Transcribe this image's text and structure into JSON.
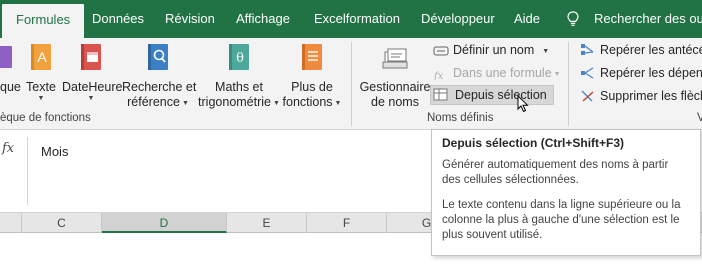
{
  "tabs": {
    "formules": "Formules",
    "donnees": "Données",
    "revision": "Révision",
    "affichage": "Affichage",
    "excelformation": "Excelformation",
    "developpeur": "Développeur",
    "aide": "Aide",
    "search": "Rechercher des outils"
  },
  "ribbon": {
    "func_library": {
      "partial_button": "que",
      "texte": "Texte",
      "dateheure": "DateHeure",
      "recherche_line1": "Recherche et",
      "recherche_line2": "référence",
      "maths_line1": "Maths et",
      "maths_line2": "trigonométrie",
      "plus_line1": "Plus de",
      "plus_line2": "fonctions",
      "group_label": "èque de fonctions"
    },
    "defined_names": {
      "gestionnaire_line1": "Gestionnaire",
      "gestionnaire_line2": "de noms",
      "definir_nom": "Définir un nom",
      "dans_formule": "Dans une formule",
      "depuis_selection": "Depuis sélection",
      "group_label": "Noms définis"
    },
    "auditing": {
      "reperer_antecedents": "Repérer les antécéd",
      "reperer_dependants": "Repérer les dépenda",
      "supprimer_fleches": "Supprimer les flèch",
      "group_label_partial": "V"
    }
  },
  "formula_bar": {
    "fx_label": "fx",
    "content": "Mois"
  },
  "columns": [
    "C",
    "D",
    "E",
    "F",
    "G"
  ],
  "selected_column": "D",
  "tooltip": {
    "title": "Depuis sélection (Ctrl+Shift+F3)",
    "para1": "Générer automatiquement des noms à partir des cellules sélectionnées.",
    "para2": "Le texte contenu dans la ligne supérieure ou la colonne la plus à gauche d'une sélection est le plus souvent utilisé."
  },
  "colors": {
    "brand_green": "#217346",
    "ribbon_bg": "#f3f3f3",
    "hover_bg": "#d7d7d7"
  }
}
